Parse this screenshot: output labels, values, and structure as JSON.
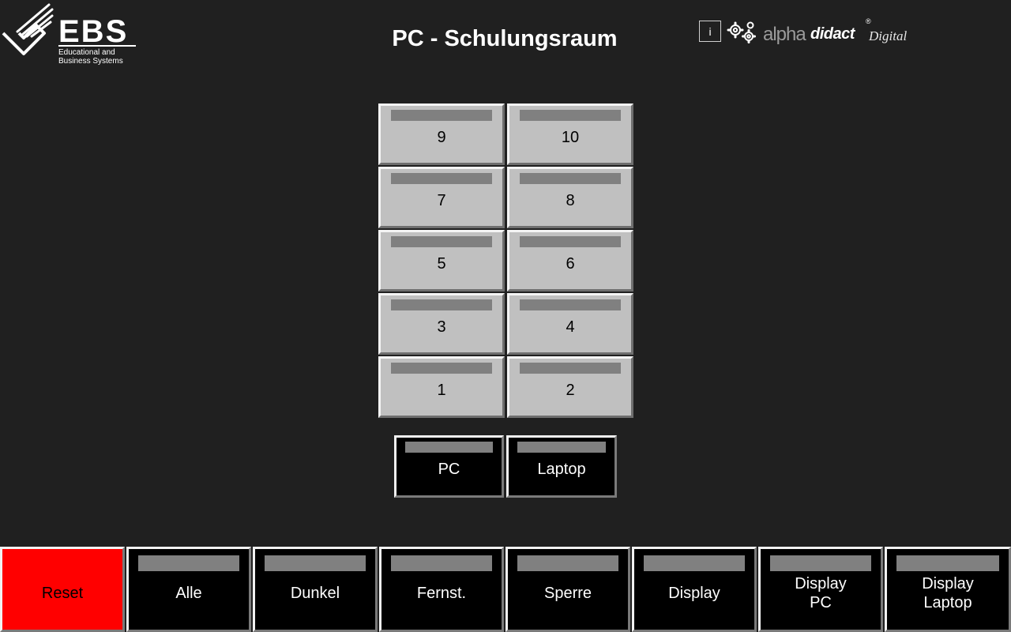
{
  "header": {
    "logo_text": "EBS",
    "logo_subtitle": "Educational and Business Systems",
    "title": "PC - Schulungsraum",
    "info_label": "i",
    "brand_alpha": "alpha",
    "brand_didact": "didact",
    "brand_reg": "®",
    "brand_digital": "Digital"
  },
  "stations": [
    "9",
    "10",
    "7",
    "8",
    "5",
    "6",
    "3",
    "4",
    "1",
    "2"
  ],
  "sources": {
    "pc": "PC",
    "laptop": "Laptop"
  },
  "bottom_bar": {
    "reset": "Reset",
    "alle": "Alle",
    "dunkel": "Dunkel",
    "fernst": "Fernst.",
    "sperre": "Sperre",
    "display": "Display",
    "display_pc_line1": "Display",
    "display_pc_line2": "PC",
    "display_laptop_line1": "Display",
    "display_laptop_line2": "Laptop"
  },
  "colors": {
    "background": "#202020",
    "tile": "#c0c0c0",
    "tile_bar": "#808080",
    "reset": "#ff0000",
    "button_black": "#000000"
  }
}
